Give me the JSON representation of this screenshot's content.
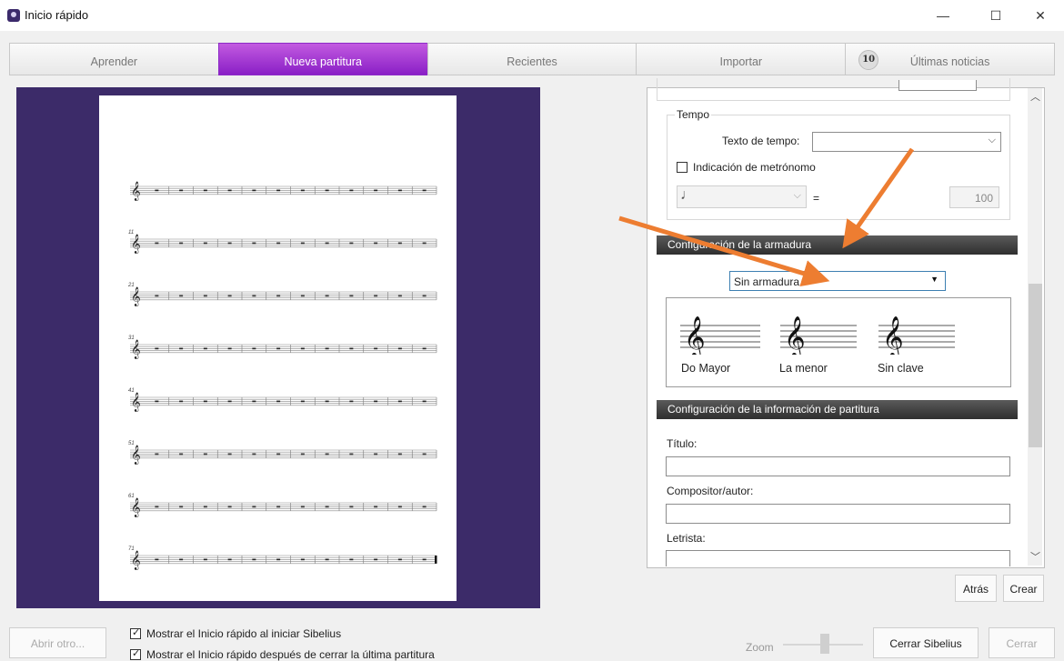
{
  "window": {
    "title": "Inicio rápido",
    "minimize_glyph": "—",
    "maximize_glyph": "☐",
    "close_glyph": "✕"
  },
  "tabs": [
    {
      "label": "Aprender"
    },
    {
      "label": "Nueva partitura"
    },
    {
      "label": "Recientes"
    },
    {
      "label": "Importar"
    },
    {
      "label": "Últimas noticias",
      "badge": "10"
    }
  ],
  "preview": {
    "measure_numbers": [
      "",
      "11",
      "21",
      "31",
      "41",
      "51",
      "61",
      "71"
    ]
  },
  "tempo": {
    "group_label": "Tempo",
    "text_label": "Texto de tempo:",
    "text_value": "",
    "metronome_label": "Indicación de metrónomo",
    "metronome_checked": false,
    "note_symbol": "♩",
    "equals": "=",
    "bpm": "100"
  },
  "key_signature": {
    "header": "Configuración de la armadura",
    "selected": "Sin armadura",
    "options": [
      {
        "label": "Do Mayor"
      },
      {
        "label": "La menor"
      },
      {
        "label": "Sin clave"
      }
    ]
  },
  "score_info": {
    "header": "Configuración de la información de partitura",
    "title_label": "Título:",
    "title_value": "",
    "composer_label": "Compositor/autor:",
    "composer_value": "",
    "lyricist_label": "Letrista:",
    "lyricist_value": ""
  },
  "buttons": {
    "back": "Atrás",
    "create": "Crear",
    "open_other": "Abrir otro...",
    "close_sibelius": "Cerrar Sibelius",
    "close": "Cerrar"
  },
  "options": {
    "show_on_start": "Mostrar el Inicio rápido al iniciar Sibelius",
    "show_on_start_checked": true,
    "show_after_close": "Mostrar el Inicio rápido después de cerrar la última partitura",
    "show_after_close_checked": true
  },
  "zoom": {
    "label": "Zoom"
  },
  "colors": {
    "accent": "#9b30d0",
    "preview_bg": "#3c2b69",
    "arrow": "#ed7d31"
  }
}
